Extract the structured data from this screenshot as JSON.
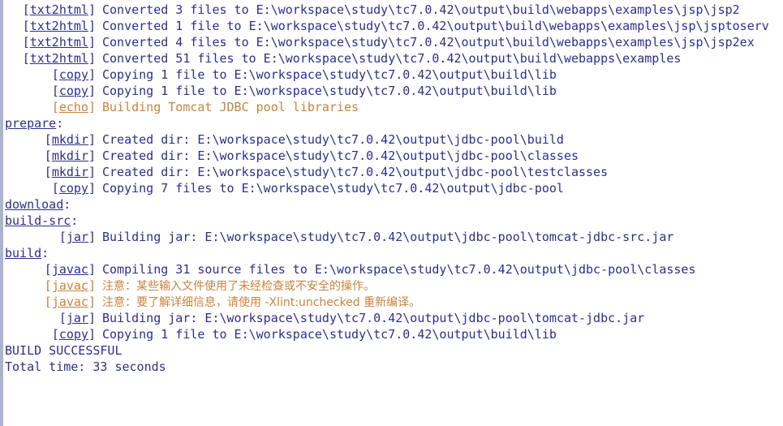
{
  "console": {
    "name": "ant-build-console",
    "background_color": "#ffffff",
    "border_color": "#aab4cc",
    "colors": {
      "info": "#2e2e8c",
      "warning": "#c8833c",
      "target": "#2e2e8c"
    },
    "lines": [
      {
        "kind": "task",
        "task": "txt2html",
        "color": "info",
        "message": "Converted 3 files to E:\\workspace\\study\\tc7.0.42\\output\\build\\webapps\\examples\\jsp\\jsp2"
      },
      {
        "kind": "task",
        "task": "txt2html",
        "color": "info",
        "message": "Converted 1 file to E:\\workspace\\study\\tc7.0.42\\output\\build\\webapps\\examples\\jsp\\jsptoserv"
      },
      {
        "kind": "task",
        "task": "txt2html",
        "color": "info",
        "message": "Converted 4 files to E:\\workspace\\study\\tc7.0.42\\output\\build\\webapps\\examples\\jsp\\jsp2ex"
      },
      {
        "kind": "task",
        "task": "txt2html",
        "color": "info",
        "message": "Converted 51 files to E:\\workspace\\study\\tc7.0.42\\output\\build\\webapps\\examples"
      },
      {
        "kind": "task",
        "task": "copy",
        "color": "info",
        "message": "Copying 1 file to E:\\workspace\\study\\tc7.0.42\\output\\build\\lib"
      },
      {
        "kind": "task",
        "task": "copy",
        "color": "info",
        "message": "Copying 1 file to E:\\workspace\\study\\tc7.0.42\\output\\build\\lib"
      },
      {
        "kind": "task",
        "task": "echo",
        "color": "warning",
        "message": "Building Tomcat JDBC pool libraries"
      },
      {
        "kind": "target",
        "color": "target",
        "name": "prepare",
        "colon": ":"
      },
      {
        "kind": "task",
        "task": "mkdir",
        "color": "info",
        "message": "Created dir: E:\\workspace\\study\\tc7.0.42\\output\\jdbc-pool\\build"
      },
      {
        "kind": "task",
        "task": "mkdir",
        "color": "info",
        "message": "Created dir: E:\\workspace\\study\\tc7.0.42\\output\\jdbc-pool\\classes"
      },
      {
        "kind": "task",
        "task": "mkdir",
        "color": "info",
        "message": "Created dir: E:\\workspace\\study\\tc7.0.42\\output\\jdbc-pool\\testclasses"
      },
      {
        "kind": "task",
        "task": "copy",
        "color": "info",
        "message": "Copying 7 files to E:\\workspace\\study\\tc7.0.42\\output\\jdbc-pool"
      },
      {
        "kind": "target",
        "color": "target",
        "name": "download",
        "colon": ":"
      },
      {
        "kind": "target",
        "color": "target",
        "name": "build-src",
        "colon": ":"
      },
      {
        "kind": "task",
        "task": "jar",
        "color": "info",
        "message": "Building jar: E:\\workspace\\study\\tc7.0.42\\output\\jdbc-pool\\tomcat-jdbc-src.jar"
      },
      {
        "kind": "target",
        "color": "target",
        "name": "build",
        "colon": ":"
      },
      {
        "kind": "task",
        "task": "javac",
        "color": "info",
        "message": "Compiling 31 source files to E:\\workspace\\study\\tc7.0.42\\output\\jdbc-pool\\classes"
      },
      {
        "kind": "task",
        "task": "javac",
        "color": "warning",
        "cjk": true,
        "message": "注意：某些输入文件使用了未经检查或不安全的操作。"
      },
      {
        "kind": "task",
        "task": "javac",
        "color": "warning",
        "cjk": true,
        "message": "注意：要了解详细信息，请使用 -Xlint:unchecked 重新编译。"
      },
      {
        "kind": "task",
        "task": "jar",
        "color": "info",
        "message": "Building jar: E:\\workspace\\study\\tc7.0.42\\output\\jdbc-pool\\tomcat-jdbc.jar"
      },
      {
        "kind": "task",
        "task": "copy",
        "color": "info",
        "message": "Copying 1 file to E:\\workspace\\study\\tc7.0.42\\output\\build\\lib"
      },
      {
        "kind": "plain",
        "color": "info",
        "message": "BUILD SUCCESSFUL"
      },
      {
        "kind": "plain",
        "color": "info",
        "message": "Total time: 33 seconds"
      }
    ]
  }
}
